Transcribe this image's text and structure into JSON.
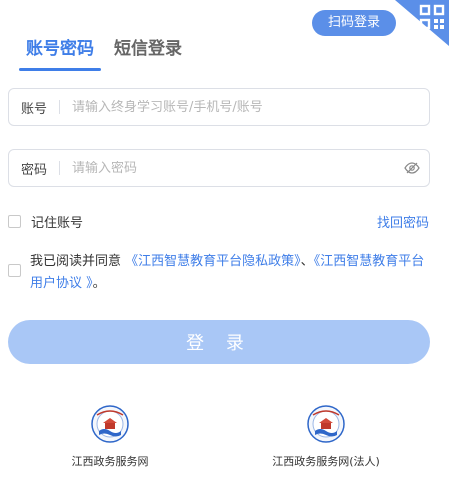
{
  "top": {
    "scan_login": "扫码登录"
  },
  "tabs": [
    {
      "label": "账号密码",
      "active": true
    },
    {
      "label": "短信登录",
      "active": false
    }
  ],
  "account": {
    "label": "账号",
    "placeholder": "请输入终身学习账号/手机号/账号",
    "value": ""
  },
  "password": {
    "label": "密码",
    "placeholder": "请输入密码",
    "value": ""
  },
  "remember": {
    "label": "记住账号",
    "checked": false
  },
  "forgot": "找回密码",
  "agreement": {
    "prefix": "我已阅读并同意",
    "privacy_link": "《江西智慧教育平台隐私政策》",
    "sep": "、",
    "user_link": "《江西智慧教育平台用户协议 》",
    "suffix": "。",
    "checked": false
  },
  "login_button": "登 录",
  "external_logins": [
    {
      "label": "江西政务服务网"
    },
    {
      "label": "江西政务服务网(法人)"
    }
  ],
  "colors": {
    "accent": "#3f7ee8",
    "corner": "#5b8fe8",
    "button_disabled": "#a9c7f6"
  }
}
